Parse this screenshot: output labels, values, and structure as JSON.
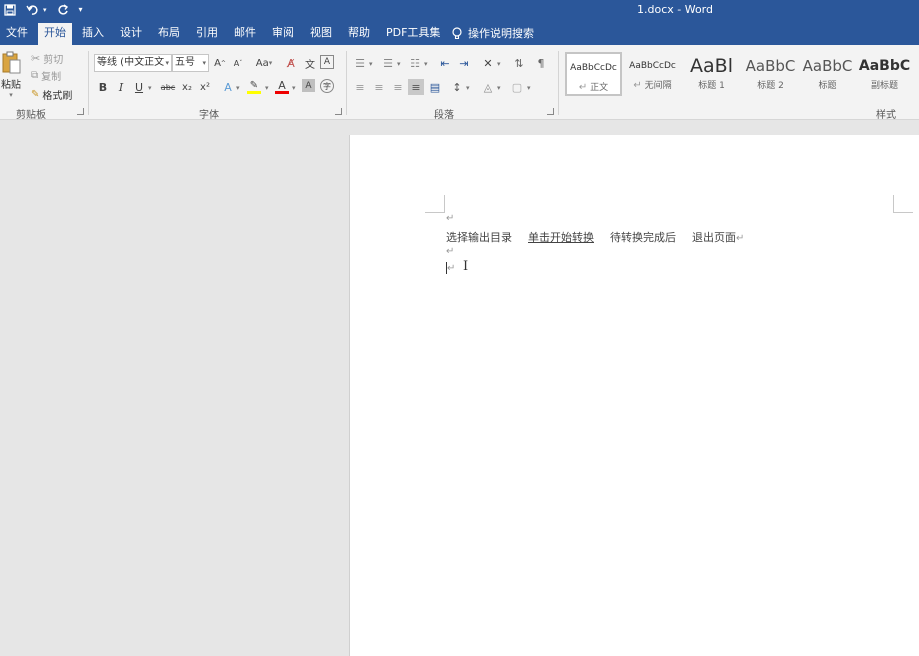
{
  "titlebar": {
    "title": "1.docx  -  Word",
    "qat": [
      "save-icon",
      "undo-icon",
      "redo-icon",
      "customize-icon"
    ],
    "bg_color": "#2b579a"
  },
  "tabs": [
    {
      "label": "文件",
      "active": false
    },
    {
      "label": "开始",
      "active": true
    },
    {
      "label": "插入",
      "active": false
    },
    {
      "label": "设计",
      "active": false
    },
    {
      "label": "布局",
      "active": false
    },
    {
      "label": "引用",
      "active": false
    },
    {
      "label": "邮件",
      "active": false
    },
    {
      "label": "审阅",
      "active": false
    },
    {
      "label": "视图",
      "active": false
    },
    {
      "label": "帮助",
      "active": false
    },
    {
      "label": "PDF工具集",
      "active": false
    }
  ],
  "tell_me": {
    "label": "操作说明搜索",
    "icon": "lightbulb-icon"
  },
  "clipboard": {
    "paste": "粘贴",
    "cut": "剪切",
    "copy": "复制",
    "format_painter": "格式刷",
    "group_label": "剪贴板"
  },
  "font": {
    "font_name": "等线 (中文正文",
    "font_size": "五号",
    "bold": "B",
    "italic": "I",
    "underline": "U",
    "strike": "abc",
    "subscript": "x₂",
    "superscript": "x²",
    "change_case": "Aa",
    "grow": "A",
    "shrink": "A",
    "group_label": "字体"
  },
  "paragraph": {
    "group_label": "段落"
  },
  "styles": {
    "group_label": "样式",
    "items": [
      {
        "preview": "AaBbCcDc",
        "name": "正文",
        "selected": true
      },
      {
        "preview": "AaBbCcDc",
        "name": "无间隔",
        "selected": false
      },
      {
        "preview": "AaBl",
        "name": "标题 1",
        "selected": false
      },
      {
        "preview": "AaBbC",
        "name": "标题 2",
        "selected": false
      },
      {
        "preview": "AaBbC",
        "name": "标题",
        "selected": false
      },
      {
        "preview": "AaBbC",
        "name": "副标题",
        "selected": false
      }
    ]
  },
  "document": {
    "para_mark": "↵",
    "line1": {
      "part1": "选择输出目录",
      "part2": "单击开始转换",
      "part3": "待转换完成后",
      "part4": "退出页面"
    }
  }
}
